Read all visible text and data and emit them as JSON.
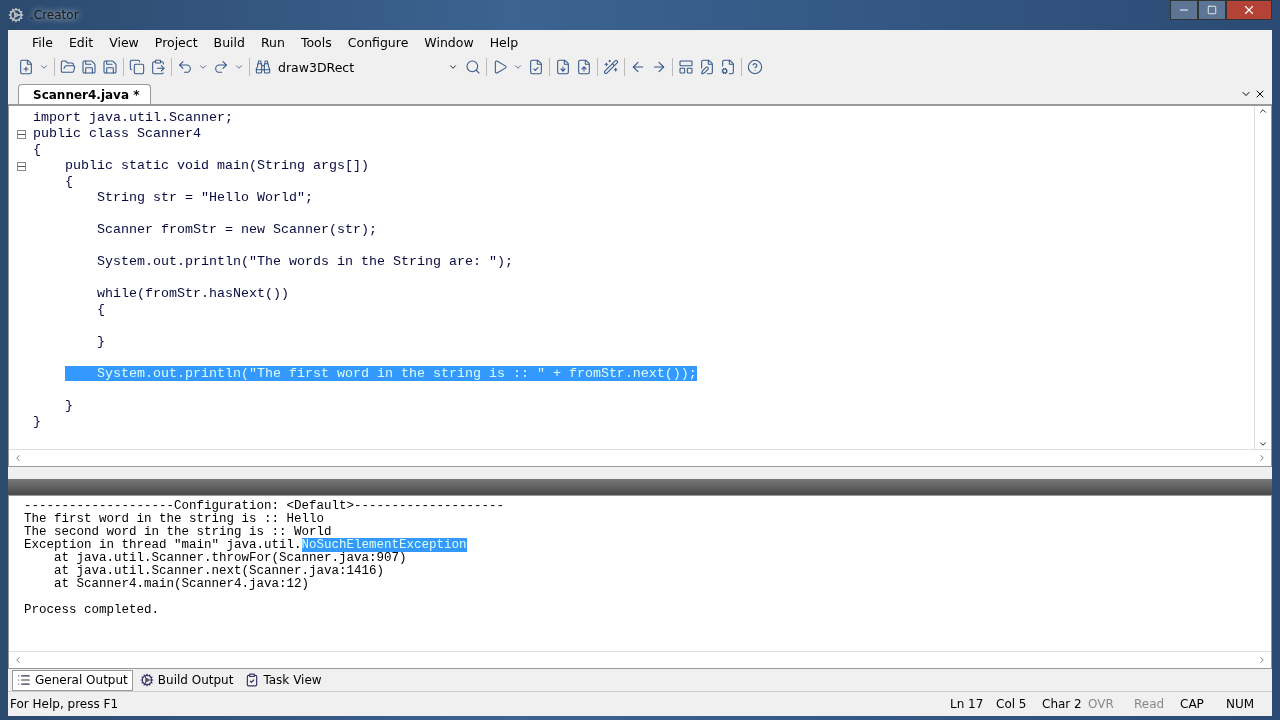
{
  "window": {
    "title": ".Creator"
  },
  "menu": [
    "File",
    "Edit",
    "View",
    "Project",
    "Build",
    "Run",
    "Tools",
    "Configure",
    "Window",
    "Help"
  ],
  "toolbar": {
    "find_combo": {
      "value": "draw3DRect"
    }
  },
  "editor": {
    "tabs": [
      {
        "label": "Scanner4.java *",
        "selected": true
      }
    ],
    "lines": [
      {
        "text": "import java.util.Scanner;",
        "fold": false,
        "selected": false
      },
      {
        "text": "public class Scanner4",
        "fold": true,
        "selected": false
      },
      {
        "text": "{",
        "fold": false,
        "selected": false
      },
      {
        "text": "    public static void main(String args[])",
        "fold": true,
        "selected": false
      },
      {
        "text": "    {",
        "fold": false,
        "selected": false
      },
      {
        "text": "        String str = \"Hello World\";",
        "fold": false,
        "selected": false
      },
      {
        "fold": false,
        "selected": false
      },
      {
        "text": "        Scanner fromStr = new Scanner(str);",
        "fold": false,
        "selected": false
      },
      {
        "fold": false,
        "selected": false
      },
      {
        "text": "        System.out.println(\"The words in the String are: \");",
        "fold": false,
        "selected": false
      },
      {
        "fold": false,
        "selected": false
      },
      {
        "text": "        while(fromStr.hasNext())",
        "fold": false,
        "selected": false
      },
      {
        "text": "        {",
        "fold": false,
        "selected": false
      },
      {
        "fold": false,
        "selected": false
      },
      {
        "text": "        }",
        "fold": false,
        "selected": false
      },
      {
        "fold": false,
        "selected": false
      },
      {
        "text": "        System.out.println(\"The first word in the string is :: \" + fromStr.next());",
        "fold": false,
        "selected": true
      },
      {
        "fold": false,
        "selected": false
      },
      {
        "text": "    }",
        "fold": false,
        "selected": false
      },
      {
        "text": "}",
        "fold": false,
        "selected": false
      }
    ]
  },
  "output": {
    "lines": [
      {
        "kind": "log",
        "segments": [
          {
            "text": "--------------------Configuration: <Default>--------------------",
            "selected": false
          }
        ]
      },
      {
        "kind": "log",
        "segments": [
          {
            "text": "The first word in the string is :: Hello",
            "selected": false
          }
        ]
      },
      {
        "kind": "log",
        "segments": [
          {
            "text": "The second word in the string is :: World",
            "selected": false
          }
        ]
      },
      {
        "kind": "log",
        "segments": [
          {
            "text": "Exception in thread \"main\" java.util.",
            "selected": false
          },
          {
            "text": "NoSuchElementException",
            "selected": true
          }
        ]
      },
      {
        "kind": "log",
        "segments": [
          {
            "text": "    at java.util.Scanner.throwFor(Scanner.java:907)",
            "selected": false
          }
        ]
      },
      {
        "kind": "log",
        "segments": [
          {
            "text": "    at java.util.Scanner.next(Scanner.java:1416)",
            "selected": false
          }
        ]
      },
      {
        "kind": "log",
        "segments": [
          {
            "text": "    at Scanner4.main(Scanner4.java:12)",
            "selected": false
          }
        ]
      },
      {
        "kind": "summary",
        "segments": [
          {
            "text": "Process completed.",
            "selected": false
          }
        ]
      }
    ],
    "tabs": [
      {
        "label": "General Output",
        "kind": "list",
        "selected": true
      },
      {
        "label": "Build Output",
        "kind": "build",
        "selected": false
      },
      {
        "label": "Task View",
        "kind": "task",
        "selected": false
      }
    ]
  },
  "status_bar": {
    "help": "For Help, press F1",
    "indicators": [
      {
        "text": "Ln 17",
        "disabled": false
      },
      {
        "text": "Col 5",
        "disabled": false
      },
      {
        "text": "Char 2",
        "disabled": false
      },
      {
        "text": "OVR",
        "disabled": true
      },
      {
        "text": "Read",
        "disabled": true
      },
      {
        "text": "CAP",
        "disabled": false
      },
      {
        "text": "NUM",
        "disabled": false
      }
    ]
  }
}
